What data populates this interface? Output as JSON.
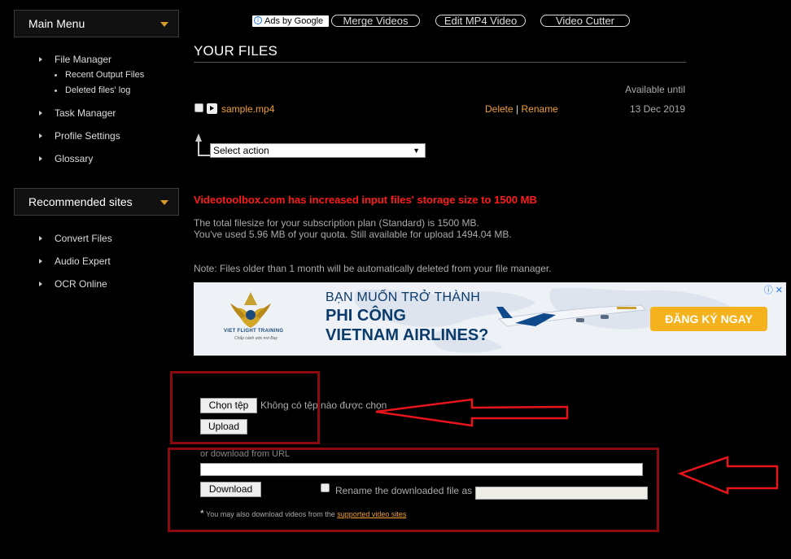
{
  "sidebar": {
    "main_menu_title": "Main Menu",
    "main_items": [
      {
        "label": "File Manager"
      },
      {
        "label": "Task Manager"
      },
      {
        "label": "Profile Settings"
      },
      {
        "label": "Glossary"
      }
    ],
    "sub_items": [
      {
        "label": "Recent Output Files"
      },
      {
        "label": "Deleted files' log"
      }
    ],
    "recommended_title": "Recommended sites",
    "recommended_items": [
      {
        "label": "Convert Files"
      },
      {
        "label": "Audio Expert"
      },
      {
        "label": "OCR Online"
      }
    ]
  },
  "topbar": {
    "ads_label": "Ads by Google",
    "links": [
      "Merge Videos",
      "Edit MP4 Video",
      "Video Cutter"
    ]
  },
  "files": {
    "title": "YOUR FILES",
    "col_available": "Available until",
    "rows": [
      {
        "name": "sample.mp4",
        "delete": "Delete",
        "separator": "|",
        "rename": "Rename",
        "date": "13 Dec 2019"
      }
    ],
    "select_action": "Select action"
  },
  "notice": {
    "headline": "Videotoolbox.com has increased input files' storage size to 1500 MB",
    "line1": "The total filesize for your subscription plan (Standard) is 1500 MB.",
    "line2": "You've used 5.96 MB of your quota. Still available for upload 1494.04 MB.",
    "note": "Note: Files older than 1 month will be automatically deleted from your file manager."
  },
  "ad": {
    "line1": "BẠN MUỐN TRỞ THÀNH",
    "line2": "PHI CÔNG",
    "line3": "VIETNAM AIRLINES?",
    "cta": "ĐĂNG KÝ NGAY",
    "logo_text": "VIET FLIGHT TRAINING",
    "logo_sub": "Chắp cánh ước mơ Bay",
    "adchoice": "ⓘ ✕"
  },
  "upload": {
    "choose_label": "Chọn tệp",
    "no_file_text": "Không có tệp nào được chọn",
    "upload_label": "Upload",
    "url_label": "or download from URL",
    "download_label": "Download",
    "rename_label": "Rename the downloaded file as",
    "footnote_star": "*",
    "footnote": "You may also download videos from the",
    "footnote_link": "supported video sites"
  },
  "colors": {
    "accent": "#f0a030",
    "warning": "#ff1a1a",
    "annotation": "#8b0a10"
  }
}
